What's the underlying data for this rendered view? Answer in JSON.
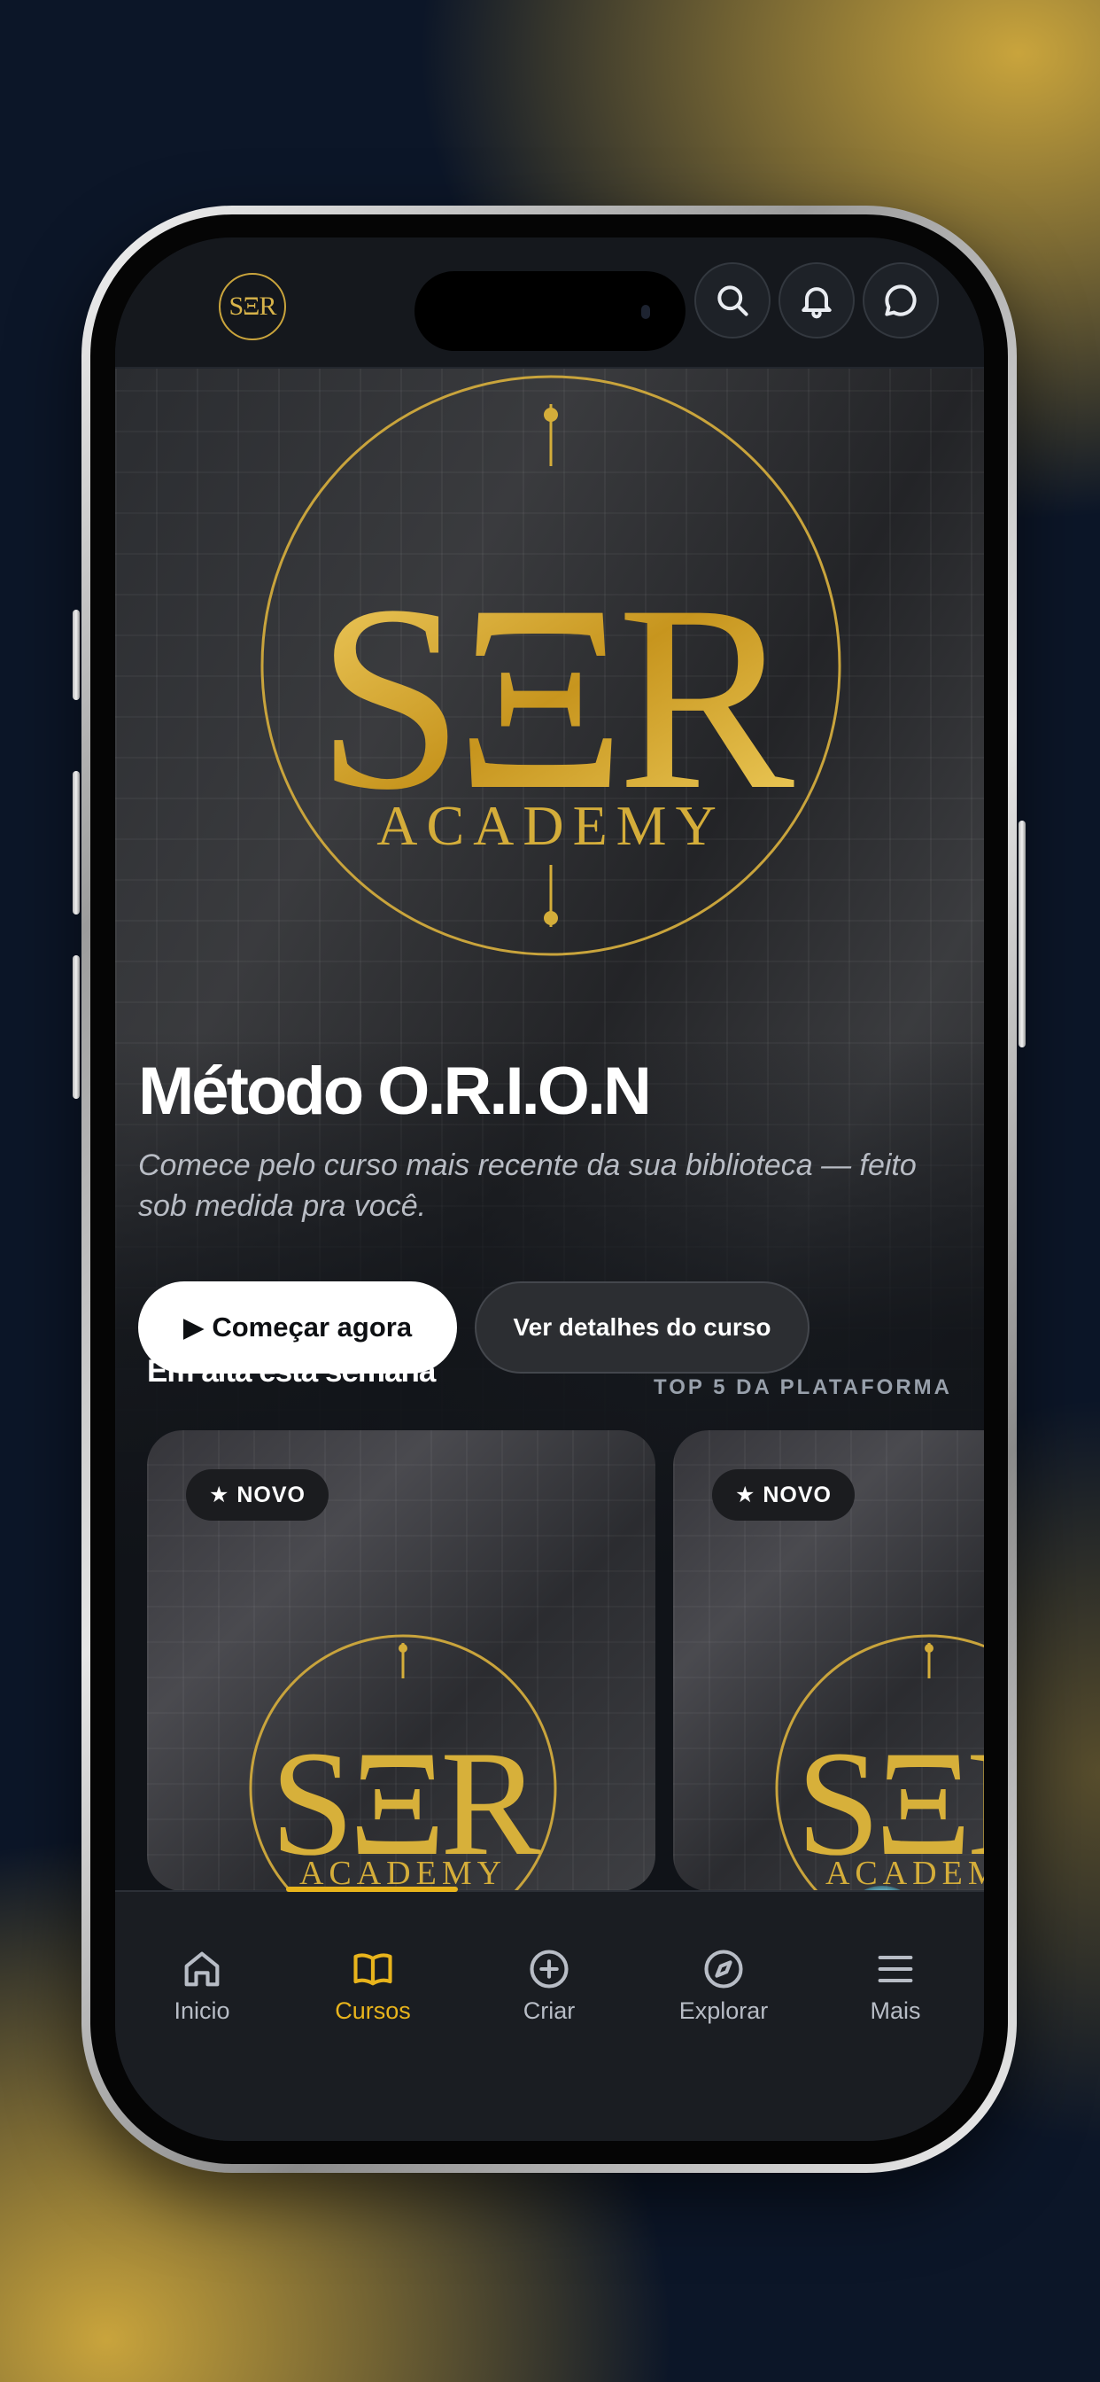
{
  "header": {
    "logo_text": "SΞR",
    "icons": [
      "search-icon",
      "bell-icon",
      "chat-icon"
    ]
  },
  "hero": {
    "logo_main": "SΞR",
    "logo_sub": "ACADEMY",
    "title": "Método O.R.I.O.N",
    "subtitle": "Comece pelo curso mais recente da sua biblioteca — feito sob medida pra você.",
    "primary_button": "▶ Começar agora",
    "secondary_button": "Ver detalhes do curso"
  },
  "trending": {
    "title": "Em alta esta semana",
    "link": "TOP 5 DA PLATAFORMA",
    "cards": [
      {
        "badge": "★ NOVO",
        "logo_main": "SΞR",
        "logo_sub": "ACADEMY"
      },
      {
        "badge": "★ NOVO",
        "logo_main": "SΞR",
        "logo_sub": "ACADEMY"
      }
    ]
  },
  "tabbar": {
    "items": [
      {
        "label": "Inicio",
        "icon": "home-icon"
      },
      {
        "label": "Cursos",
        "icon": "book-icon",
        "active": true
      },
      {
        "label": "Criar",
        "icon": "plus-circle-icon"
      },
      {
        "label": "Explorar",
        "icon": "compass-icon"
      },
      {
        "label": "Mais",
        "icon": "menu-icon"
      }
    ]
  },
  "colors": {
    "gold": "#e8b41c",
    "logo_gold": "#d4ad3a",
    "background": "#101318"
  }
}
